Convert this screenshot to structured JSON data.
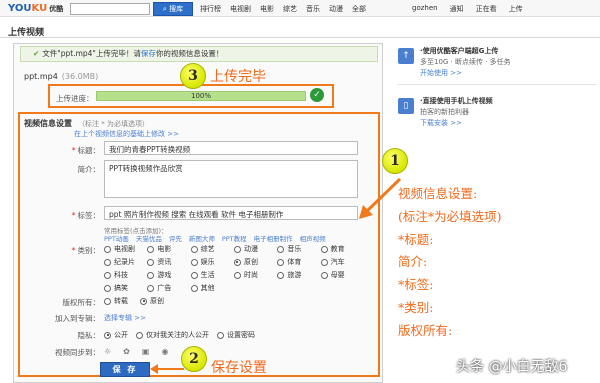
{
  "topbar": {
    "logo_main": "YOU",
    "logo_ku": "KU",
    "logo_cn": "优酷",
    "search_button": "搜库",
    "nav_items": [
      "排行榜",
      "电视剧",
      "电影",
      "综艺",
      "音乐",
      "动漫",
      "全部"
    ],
    "user_items": [
      "gozhen",
      "通知",
      "正在看",
      "上传"
    ]
  },
  "page": {
    "title": "上传视频"
  },
  "upload": {
    "notice_prefix": "文件\"ppt.mp4\"上传完毕！请",
    "notice_save": "保存",
    "notice_suffix": "你的视频信息设置！",
    "file_name": "ppt.mp4",
    "file_size": "(36.0MB)",
    "progress_label": "上传进度：",
    "progress_text": "100%",
    "progress_value": 100
  },
  "info": {
    "heading": "视频信息设置",
    "heading_note": "（标注 * 为必填选项）",
    "sub_link": "在上个视频信息的基础上修改 >>",
    "title_label": "标题：",
    "title_value": "我们的青春PPT转换视频",
    "desc_label": "简介：",
    "desc_value": "PPT转换视频作品欣赏",
    "tags_label": "标签：",
    "tags_value": "ppt 照片制作视频 搜索 在线观看 软件 电子相册制作",
    "tags_suggest": "常用标签(点击添加)：",
    "tag_links": [
      "PPT动画",
      "天猫优品",
      "评先",
      "新图大师",
      "PPT教程",
      "电子相册制作",
      "相声视频"
    ],
    "category_label": "类别：",
    "categories": [
      {
        "label": "电视剧",
        "checked": false
      },
      {
        "label": "电影",
        "checked": false
      },
      {
        "label": "综艺",
        "checked": false
      },
      {
        "label": "动漫",
        "checked": false
      },
      {
        "label": "音乐",
        "checked": false
      },
      {
        "label": "教育",
        "checked": false
      },
      {
        "label": "纪录片",
        "checked": false
      },
      {
        "label": "资讯",
        "checked": false
      },
      {
        "label": "娱乐",
        "checked": false
      },
      {
        "label": "原创",
        "checked": true
      },
      {
        "label": "体育",
        "checked": false
      },
      {
        "label": "汽车",
        "checked": false
      },
      {
        "label": "科技",
        "checked": false
      },
      {
        "label": "游戏",
        "checked": false
      },
      {
        "label": "生活",
        "checked": false
      },
      {
        "label": "时尚",
        "checked": false
      },
      {
        "label": "旅游",
        "checked": false
      },
      {
        "label": "母婴",
        "checked": false
      },
      {
        "label": "搞笑",
        "checked": false
      },
      {
        "label": "广告",
        "checked": false
      },
      {
        "label": "其他",
        "checked": false
      }
    ],
    "copyright_label": "版权所有：",
    "copyright_options": [
      {
        "label": "转载",
        "checked": false
      },
      {
        "label": "原创",
        "checked": true
      }
    ],
    "album_label": "加入到专辑：",
    "album_link": "选择专辑 >>",
    "privacy_label": "隐私：",
    "privacy_options": [
      {
        "label": "公开",
        "checked": true
      },
      {
        "label": "仅对我关注的人公开",
        "checked": false
      },
      {
        "label": "设置密码",
        "checked": false
      }
    ],
    "share_label": "视频同步到：",
    "save_button": "保 存"
  },
  "sidebar": {
    "promo1_title": "·使用优酷客户端超G上传",
    "promo1_desc": "多至10G · 断点续传 · 多任务",
    "promo1_link": "开始使用 >>",
    "promo2_title": "·直接使用手机上传视频",
    "promo2_desc": "拍客的新拍利器",
    "promo2_link": "下载安装 >>"
  },
  "annotations": {
    "badge1": "1",
    "badge2": "2",
    "badge3": "3",
    "callout_upload": "上传完毕",
    "callout_save": "保存设置",
    "guide_lines": [
      "视频信息设置:",
      "(标注*为必填选项)",
      "*标题:",
      "简介:",
      "*标签:",
      "*类别:",
      "版权所有:"
    ]
  },
  "watermark": "头条 @小白无敌6",
  "colors": {
    "accent_orange": "#f07a1a",
    "brand_blue": "#2f6ac2",
    "progress_green": "#b6e08c"
  }
}
